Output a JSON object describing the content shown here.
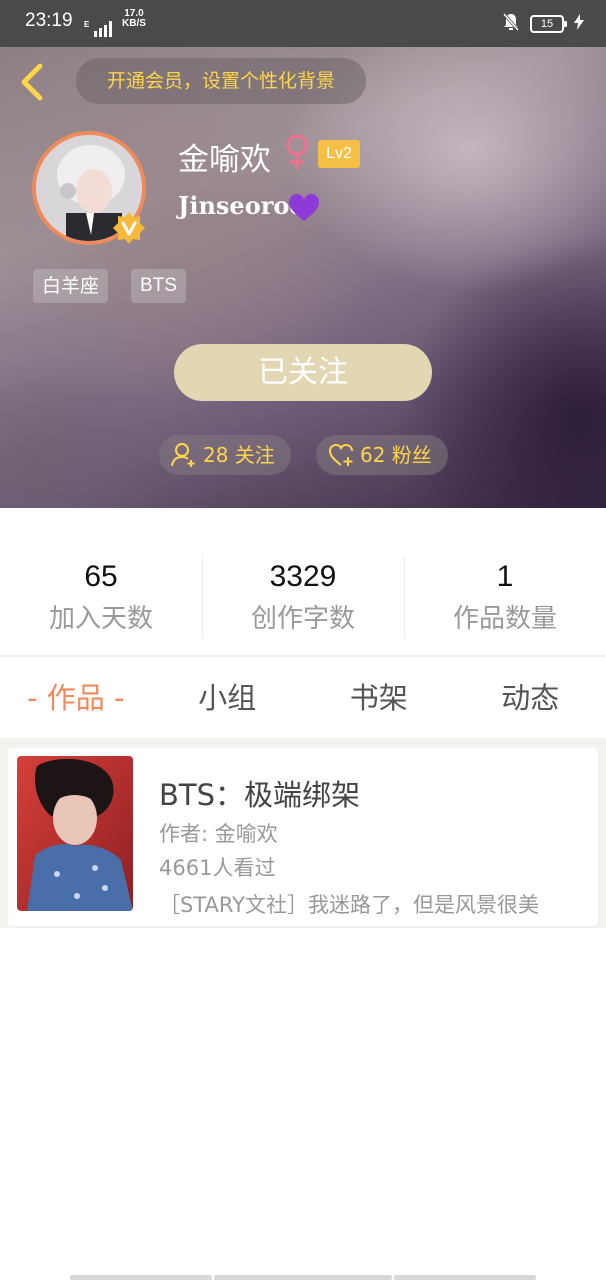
{
  "status_bar": {
    "time": "23:19",
    "network_type": "E",
    "speed_value": "17.0",
    "speed_unit": "KB/S",
    "battery": "15"
  },
  "header": {
    "vip_prompt": "开通会员，设置个性化背景",
    "username": "金喻欢",
    "gender": "female",
    "level": "Lv2",
    "signature": "Jinseoroe",
    "tags": [
      "白羊座",
      "BTS"
    ],
    "follow_button_label": "已关注",
    "following_label": "28 关注",
    "fans_label": "62 粉丝"
  },
  "stats": [
    {
      "value": "65",
      "label": "加入天数"
    },
    {
      "value": "3329",
      "label": "创作字数"
    },
    {
      "value": "1",
      "label": "作品数量"
    }
  ],
  "tabs": [
    {
      "label": "- 作品 -",
      "active": true
    },
    {
      "label": "小组",
      "active": false
    },
    {
      "label": "书架",
      "active": false
    },
    {
      "label": "动态",
      "active": false
    }
  ],
  "works": [
    {
      "title": "BTS：极端绑架",
      "author": "作者: 金喻欢",
      "views": "4661人看过",
      "description": "［STARY文社］我迷路了，但是风景很美"
    }
  ],
  "colors": {
    "accent": "#f08a5a",
    "gold": "#ffd54a",
    "follow_button": "#e3d7b3",
    "level_badge": "#f6c047"
  }
}
